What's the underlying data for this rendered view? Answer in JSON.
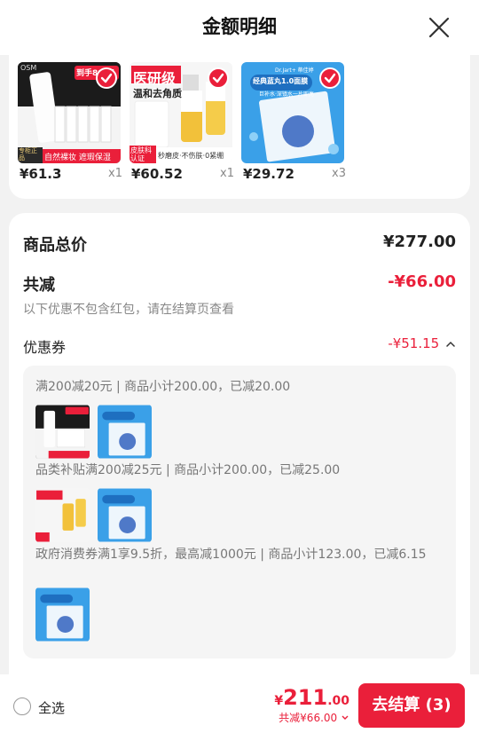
{
  "header": {
    "title": "金额明细"
  },
  "products": [
    {
      "price": "¥61.3",
      "qty": "x1",
      "image": "cleanser-tubes",
      "badge": "到手80ml",
      "tag": "专柜正品",
      "strip": "自然裸妆 遮瑕保湿",
      "brand": "OSM"
    },
    {
      "price": "¥60.52",
      "qty": "x1",
      "image": "serum-bottles",
      "badge": "医研级",
      "sub": "温和去角质",
      "tag": "皮肤科认证",
      "strip": "秒磨皮·不伤肤·0紧绷"
    },
    {
      "price": "¥29.72",
      "qty": "x3",
      "image": "blue-face-mask",
      "brand": "Dr.Jart+ 蒂佳婷",
      "badge": "经典蓝丸1.0面膜",
      "strip": "巨补水·深镇水一片即亮"
    }
  ],
  "summary": {
    "total_label": "商品总价",
    "total_value": "¥277.00",
    "discount_label": "共减",
    "discount_value": "-¥66.00",
    "discount_note": "以下优惠不包含红包，请在结算页查看",
    "coupon_label": "优惠券",
    "coupon_value": "-¥51.15"
  },
  "coupon_details": [
    {
      "text": "满200减20元 | 商品小计200.00，已减20.00",
      "items": [
        "cleanser-tubes",
        "blue-face-mask"
      ]
    },
    {
      "text": "品类补贴满200减25元 | 商品小计200.00，已减25.00",
      "items": [
        "serum-bottles",
        "blue-face-mask"
      ]
    },
    {
      "text": "政府消费券满1享9.5折，最高减1000元 | 商品小计123.00，已减6.15",
      "items": [
        "blue-face-mask"
      ]
    }
  ],
  "bottom_bar": {
    "select_all": "全选",
    "currency": "¥",
    "total_int": "211",
    "total_dec": ".00",
    "saved": "共减¥66.00",
    "checkout": "去结算 (3)"
  },
  "colors": {
    "accent": "#ea1f3a",
    "mask_blue": "#3aa0e8"
  }
}
